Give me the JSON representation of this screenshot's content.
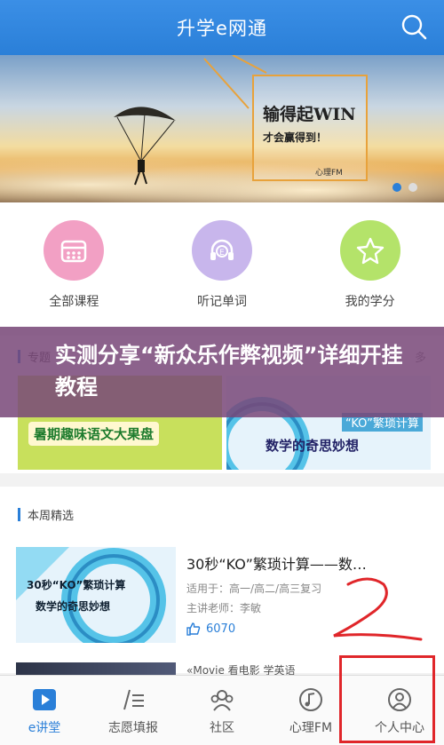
{
  "header": {
    "title": "升学e网通"
  },
  "banner": {
    "card_title": "输得起WIN",
    "card_sub": "才会赢得到！",
    "card_brand": "心理FM"
  },
  "quick_actions": [
    {
      "label": "全部课程",
      "icon": "calendar-icon",
      "color": "#f2a0c4"
    },
    {
      "label": "听记单词",
      "icon": "headphones-icon",
      "color": "#c8b6ec"
    },
    {
      "label": "我的学分",
      "icon": "star-icon",
      "color": "#b4e36a"
    }
  ],
  "topics": {
    "heading": "专题",
    "more": "多",
    "card_a": "暑期趣味语文大果盘",
    "card_b_tag": "“KO”繁琐计算",
    "card_b_title": "数学的奇思妙想"
  },
  "overlay": {
    "text": "实测分享“新众乐作弊视频”详细开挂教程"
  },
  "weekly": {
    "heading": "本周精选",
    "course": {
      "thumb_line1": "30秒“KO”繁琐计算",
      "thumb_line2": "数学的奇思妙想",
      "title": "30秒“KO”繁琐计算——数…",
      "applies": "适用于：高一/高二/高三复习",
      "teacher": "主讲老师：李敏",
      "likes": "6070"
    },
    "peek_title": "«Movie 看电影 学英语"
  },
  "tabbar": [
    {
      "label": "e讲堂",
      "icon": "play-video-icon",
      "active": true
    },
    {
      "label": "志愿填报",
      "icon": "pen-list-icon",
      "active": false
    },
    {
      "label": "社区",
      "icon": "community-icon",
      "active": false
    },
    {
      "label": "心理FM",
      "icon": "music-note-icon",
      "active": false
    },
    {
      "label": "个人中心",
      "icon": "user-icon",
      "active": false
    }
  ],
  "colors": {
    "brand": "#2a7fd8",
    "highlight": "#e0262a"
  }
}
